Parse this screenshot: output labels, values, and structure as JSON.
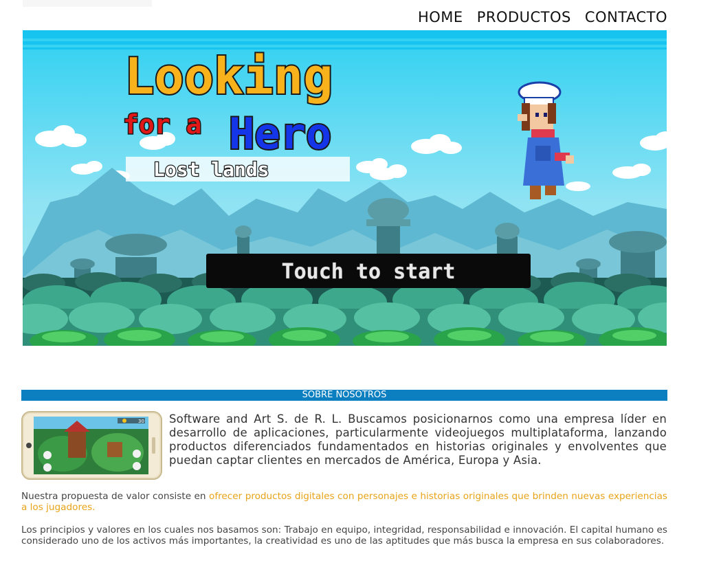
{
  "nav": {
    "home": "HOME",
    "productos": "PRODUCTOS",
    "contacto": "CONTACTO"
  },
  "banner": {
    "title_line1": "Looking",
    "title_for_a": "for a",
    "title_hero": "Hero",
    "subtitle": "Lost lands",
    "start_button": "Touch to start",
    "colors": {
      "sky": "#6fd2ea",
      "title_yellow": "#f7b21c",
      "title_red": "#e01818",
      "title_blue": "#1436e8",
      "start_bg": "#0a0a0a"
    }
  },
  "about": {
    "section_title": "SOBRE NOSOTROS",
    "intro": "Software and Art S. de R. L. Buscamos posicionarnos como una empresa líder en desarrollo de aplicaciones, particularmente videojuegos multiplataforma, lanzando productos diferenciados fundamentados en historias originales y envolventes que puedan captar clientes en mercados de América, Europa y Asia.",
    "value_prefix": "Nuestra propuesta de valor consiste en ",
    "value_highlight": "ofrecer productos digitales con personajes e historias originales que brinden nuevas experiencias a los jugadores.",
    "principles": "Los principios y valores en los cuales nos basamos son: Trabajo en equipo, integridad, responsabilidad e innovación. El capital humano es considerado uno de los activos más importantes, la creatividad es uno de las aptitudes que más busca la empresa en sus colaboradores.",
    "phone_hud": "30",
    "colors": {
      "section_bar": "#0c7fc1",
      "highlight": "#e8a317"
    }
  }
}
